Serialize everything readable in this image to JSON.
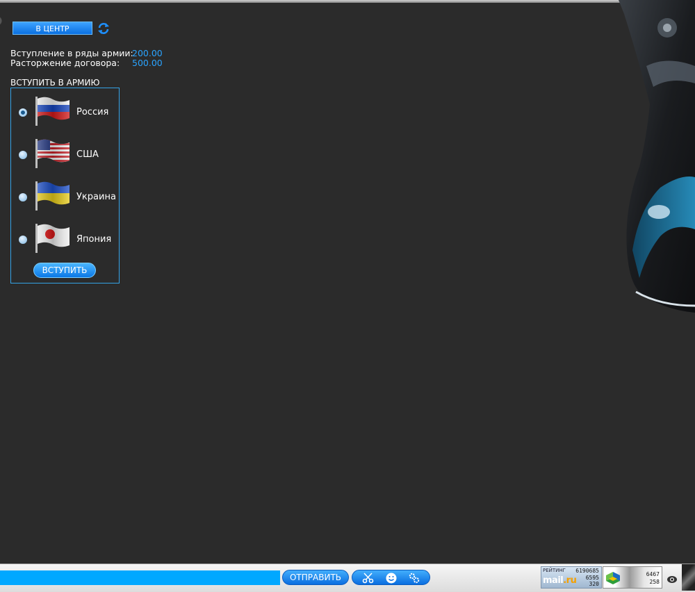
{
  "header": {
    "center_button_label": "В ЦЕНТР",
    "refresh_icon": "refresh-icon"
  },
  "info": {
    "rows": [
      {
        "label": "Вступление в ряды армии:",
        "value": "200.00"
      },
      {
        "label": "Расторжение договора:",
        "value": "500.00"
      }
    ]
  },
  "join_section": {
    "title": "ВСТУПИТЬ В АРМИЮ",
    "options": [
      {
        "label": "Россия",
        "flag": "russia-flag-icon",
        "checked": true
      },
      {
        "label": "США",
        "flag": "usa-flag-icon",
        "checked": false
      },
      {
        "label": "Украина",
        "flag": "ukraine-flag-icon",
        "checked": false
      },
      {
        "label": "Япония",
        "flag": "japan-flag-icon",
        "checked": false
      }
    ],
    "join_button_label": "ВСТУПИТЬ"
  },
  "bottom_bar": {
    "chat_input_value": "",
    "send_button_label": "ОТПРАВИТЬ",
    "tools": [
      "scissors-icon",
      "smiley-icon",
      "settings-icon"
    ],
    "counter_mailru": {
      "rating_label": "РЕЙТИНГ",
      "brand_main": "mail",
      "brand_dot": ".ru",
      "numbers": [
        "6190685",
        "6595",
        "320"
      ]
    },
    "counter_li": {
      "numbers": [
        "6467",
        "258"
      ]
    }
  },
  "colors": {
    "background": "#2b2b2b",
    "accent": "#2aa4ff",
    "panel_border": "#35a4e8",
    "chat_input": "#00a8ff"
  }
}
